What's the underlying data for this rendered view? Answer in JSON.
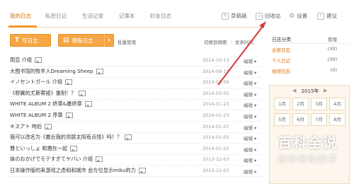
{
  "nav": {
    "tabs": [
      "我的日志",
      "私密日记",
      "生活记录",
      "记事本",
      "好友日志"
    ],
    "tools": [
      {
        "label": "草稿箱",
        "icon": "draft-icon"
      },
      {
        "label": "回收站",
        "icon": "trash-icon"
      },
      {
        "label": "设置",
        "icon": "gear-icon"
      },
      {
        "label": "建议",
        "icon": "feedback-icon"
      }
    ]
  },
  "toolbar": {
    "write_label": "写日志",
    "template_label": "模板日志",
    "batch_label": "批量管理",
    "switch_label": "切换到摘要",
    "sort_label": "发表时间"
  },
  "entries": [
    {
      "title": "雨恋 介组",
      "date": "2014-10-13",
      "edit": "编辑"
    },
    {
      "title": "大图书馆的牧羊人Dreaming Sheep",
      "date": "2014-09-19",
      "edit": "编辑"
    },
    {
      "title": "イノセントガール 介组",
      "date": "2014-03-06",
      "edit": "编辑"
    },
    {
      "title": "《秽翼的尤斯蒂娅》重制！？",
      "date": "2014-03-05",
      "edit": "编辑"
    },
    {
      "title": "WHITE ALBUM 2 终章&最终章",
      "date": "2014-01-23",
      "edit": "编辑"
    },
    {
      "title": "WHITE ALBUM 2 序章",
      "date": "2014-01-23",
      "edit": "编辑"
    },
    {
      "title": "キスアト 吻后",
      "date": "2014-01-07",
      "edit": "编辑"
    },
    {
      "title": "我可以改名为《最近我的邻居太阳有点怪》吗！？",
      "date": "2014-01-05",
      "edit": "编辑"
    },
    {
      "title": "雅といっしょ 和雅在一起",
      "date": "2014-01-02",
      "edit": "编辑"
    },
    {
      "title": "妹のおかげでモテすぎてヤバい 介组",
      "date": "2013-12-03",
      "edit": "编辑"
    },
    {
      "title": "日本操作版的来游戏之虑和和城市 会方位显示miku的力",
      "date": "2013-12-03",
      "edit": "编辑"
    }
  ],
  "sidebar": {
    "heading": "日志分类",
    "manage_label": "管理",
    "categories": [
      {
        "label": "全部日志",
        "count": "(30)"
      },
      {
        "label": "个人日记",
        "count": "(30)"
      },
      {
        "label": "视频日志",
        "count": "(0)"
      }
    ]
  },
  "calendar": {
    "year": "2015年",
    "prev": "◀",
    "next": "▶",
    "months": [
      "1月",
      "2月",
      "3月",
      "4月",
      "5月",
      "6月",
      "7月",
      "8月"
    ]
  },
  "watermark": {
    "title": "百科全说",
    "subtitle": "助你轻松解决"
  },
  "colors": {
    "accent": "#e06e00",
    "button": "#f6a644",
    "annotation_arrow": "#d93a3a"
  }
}
